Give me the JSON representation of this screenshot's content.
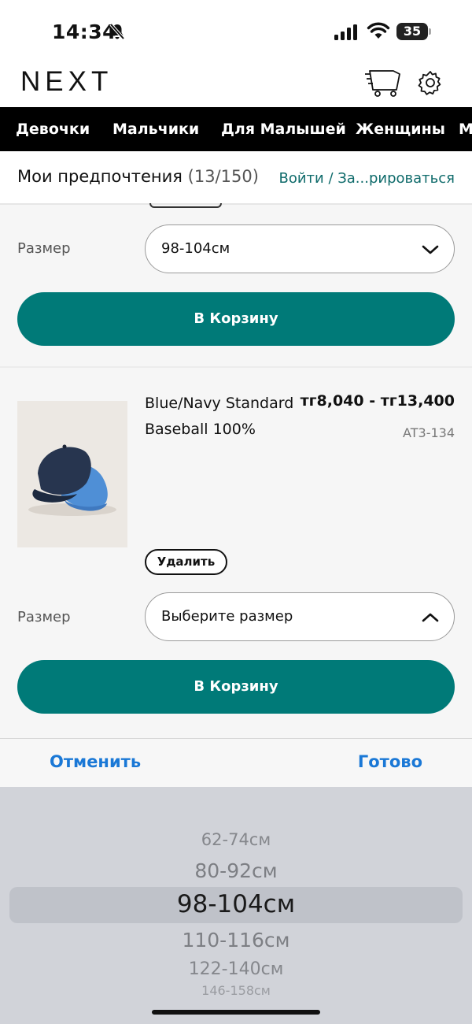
{
  "status": {
    "time": "14:34",
    "battery": "35"
  },
  "header": {
    "logo": "NEXT"
  },
  "nav": {
    "items": [
      "Девочки",
      "Мальчики",
      "Для Малышей",
      "Женщины",
      "М"
    ]
  },
  "preferences": {
    "title": "Мои предпочтения",
    "count": "(13/150)",
    "login_link": "Войти / За...рироваться"
  },
  "item1": {
    "size_label": "Размер",
    "size_value": "98-104см",
    "add_to_cart": "В Корзину"
  },
  "item2": {
    "name": "Blue/Navy Standard Baseball 100%",
    "price": "тг8,040 - тг13,400",
    "code": "AT3-134",
    "remove_label": "Удалить",
    "size_label": "Размер",
    "size_value": "Выберите размер",
    "add_to_cart": "В Корзину"
  },
  "picker": {
    "cancel": "Отменить",
    "done": "Готово",
    "options": [
      "62-74см",
      "80-92см",
      "98-104см",
      "110-116см",
      "122-140см",
      "146-158см"
    ],
    "selected_index": 2
  },
  "colors": {
    "accent": "#007a78",
    "link": "#0f6b6b",
    "picker_action": "#1a78d6"
  }
}
